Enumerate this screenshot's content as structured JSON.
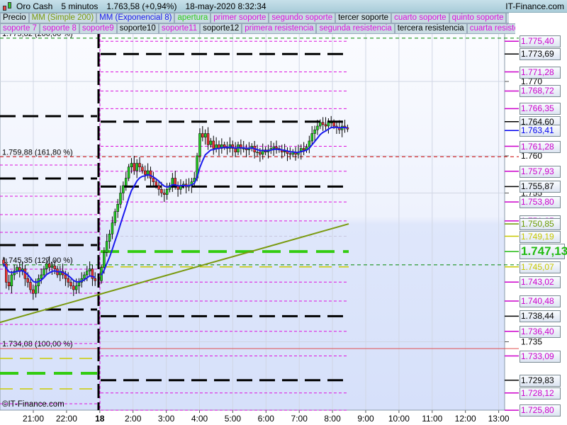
{
  "header": {
    "instrument": "Oro Cash",
    "timeframe": "5 minutos",
    "price": "1.763,58 (+0,94%)",
    "datetime": "18-may-2020 8:32:34",
    "site": "IT-Finance.com"
  },
  "legend_row1": [
    {
      "label": "Precio",
      "color": "#000000"
    },
    {
      "label": "MM (Simple 200)",
      "color": "#7a9a10"
    },
    {
      "label": "MM (Exponencial 8)",
      "color": "#1a1aee"
    },
    {
      "label": "apertura",
      "color": "#33cc22"
    },
    {
      "label": "primer soporte",
      "color": "#dd11dd"
    },
    {
      "label": "segundo soporte",
      "color": "#dd11dd"
    },
    {
      "label": "tercer soporte",
      "color": "#000000"
    },
    {
      "label": "cuarto soporte",
      "color": "#dd11dd"
    },
    {
      "label": "quinto soporte",
      "color": "#dd11dd"
    },
    {
      "label": "sexto soporte",
      "color": "#000000"
    }
  ],
  "legend_row2": [
    {
      "label": "soporte 7",
      "color": "#dd11dd"
    },
    {
      "label": "soporte 8",
      "color": "#dd11dd"
    },
    {
      "label": "soporte9",
      "color": "#dd11dd"
    },
    {
      "label": "soporte10",
      "color": "#000000"
    },
    {
      "label": "soporte11",
      "color": "#dd11dd"
    },
    {
      "label": "soporte12",
      "color": "#000000"
    },
    {
      "label": "primera resistencia",
      "color": "#dd11dd"
    },
    {
      "label": "segunda resistencia",
      "color": "#dd11dd"
    },
    {
      "label": "tercera resistencia",
      "color": "#000000"
    },
    {
      "label": "cuarta resistencia",
      "color": "#dd11dd"
    },
    {
      "label": "quinta resistencia",
      "color": "#dd11dd"
    }
  ],
  "chart_data": {
    "type": "candlestick",
    "ylim": [
      1725.2,
      1777.0
    ],
    "x_ticks": [
      "21:00",
      "22:00",
      "18",
      "2:00",
      "3:00",
      "4:00",
      "5:00",
      "6:00",
      "7:00",
      "8:00",
      "9:00",
      "10:00",
      "11:00",
      "12:00",
      "13:00"
    ],
    "y_ticks": [
      {
        "value": 1770,
        "label": "1.770"
      },
      {
        "value": 1760,
        "label": "1.760"
      },
      {
        "value": 1755,
        "label": "1.755"
      },
      {
        "value": 1735,
        "label": "1.735"
      }
    ],
    "closes_prev_session": [
      1745.5,
      1743,
      1742.5,
      1744,
      1744.5,
      1745,
      1744.5,
      1744.8,
      1743.5,
      1743,
      1742,
      1741.5,
      1742.5,
      1743.5,
      1744,
      1744.8,
      1745.5,
      1745,
      1745.2,
      1744.8,
      1744,
      1744.5,
      1744,
      1743.5,
      1743,
      1742.5,
      1742,
      1742.5,
      1743,
      1743.5,
      1744,
      1744.5,
      1744.8,
      1743.5,
      1743.2
    ],
    "closes_session": [
      1745,
      1747,
      1748.5,
      1749.5,
      1751,
      1752.5,
      1753.5,
      1755,
      1756,
      1757,
      1758.5,
      1759,
      1758,
      1759,
      1758.5,
      1758,
      1757.5,
      1758,
      1757,
      1756.5,
      1756,
      1755.5,
      1755,
      1754.8,
      1755.5,
      1756,
      1757,
      1756,
      1755.5,
      1756,
      1756.2,
      1755.8,
      1756,
      1756.5,
      1757,
      1760,
      1763,
      1762.5,
      1763,
      1761.5,
      1762,
      1761,
      1761.5,
      1761,
      1761.5,
      1761.2,
      1761,
      1761.5,
      1761,
      1760.5,
      1761.5,
      1761,
      1761,
      1760.8,
      1761,
      1761.3,
      1760.5,
      1760.5,
      1760.2,
      1760.8,
      1760.5,
      1760.8,
      1761,
      1761.2,
      1761,
      1760.8,
      1760.5,
      1760.6,
      1760.3,
      1760.2,
      1760.5,
      1760.2,
      1760.5,
      1761,
      1760.8,
      1761.2,
      1762,
      1763,
      1763.5,
      1764,
      1764.5,
      1764.2,
      1764,
      1764.5,
      1764.5,
      1764,
      1763.8,
      1763.5,
      1764,
      1763.8,
      1763.6
    ],
    "sma200": {
      "start": 1737.6,
      "end": 1750.85
    },
    "fib_levels": [
      {
        "price": 1775.82,
        "label": "1.775,82 (200,00 %)",
        "color": "#008800"
      },
      {
        "price": 1759.88,
        "label": "1.759,88 (161,80 %)",
        "color": "#cc0000"
      },
      {
        "price": 1745.35,
        "label": "1.745,35 (127,00 %)",
        "color": "#008800"
      },
      {
        "price": 1734.08,
        "label": "1.734,08 (100,00 %)",
        "color": "#e05050"
      }
    ],
    "levels_session": [
      {
        "price": 1775.4,
        "color": "#dd11dd",
        "style": "thin"
      },
      {
        "price": 1773.69,
        "color": "#000000",
        "style": "thick"
      },
      {
        "price": 1771.28,
        "color": "#dd11dd",
        "style": "thin"
      },
      {
        "price": 1768.72,
        "color": "#dd11dd",
        "style": "thin"
      },
      {
        "price": 1766.35,
        "color": "#dd11dd",
        "style": "thin"
      },
      {
        "price": 1764.6,
        "color": "#000000",
        "style": "thick"
      },
      {
        "price": 1761.28,
        "color": "#dd11dd",
        "style": "thin"
      },
      {
        "price": 1757.93,
        "color": "#dd11dd",
        "style": "thin"
      },
      {
        "price": 1755.87,
        "color": "#000000",
        "style": "thick"
      },
      {
        "price": 1753.8,
        "color": "#dd11dd",
        "style": "thin"
      },
      {
        "price": 1751.25,
        "color": "#dd11dd",
        "style": "thin"
      },
      {
        "price": 1749.19,
        "color": "#c8c8e0",
        "style": "thin"
      },
      {
        "price": 1747.13,
        "color": "#33cc11",
        "style": "open"
      },
      {
        "price": 1745.07,
        "color": "#cccc00",
        "style": "yellow"
      },
      {
        "price": 1743.02,
        "color": "#dd11dd",
        "style": "thin"
      },
      {
        "price": 1740.48,
        "color": "#dd11dd",
        "style": "thin"
      },
      {
        "price": 1738.44,
        "color": "#000000",
        "style": "thick"
      },
      {
        "price": 1736.4,
        "color": "#dd11dd",
        "style": "thin"
      },
      {
        "price": 1733.09,
        "color": "#dd11dd",
        "style": "thin"
      },
      {
        "price": 1729.83,
        "color": "#000000",
        "style": "thick"
      },
      {
        "price": 1728.12,
        "color": "#dd11dd",
        "style": "thin"
      },
      {
        "price": 1725.8,
        "color": "#dd11dd",
        "style": "thin"
      }
    ],
    "levels_prev_session": [
      {
        "price": 1765.33,
        "color": "#000000",
        "style": "thick"
      },
      {
        "price": 1758.76,
        "color": "#dd11dd",
        "style": "thin"
      },
      {
        "price": 1756.95,
        "color": "#000000",
        "style": "thick"
      },
      {
        "price": 1754.57,
        "color": "#dd11dd",
        "style": "thin"
      },
      {
        "price": 1752.1,
        "color": "#dd11dd",
        "style": "thin"
      },
      {
        "price": 1749.71,
        "color": "#dd11dd",
        "style": "thin"
      },
      {
        "price": 1748.0,
        "color": "#000000",
        "style": "thick"
      },
      {
        "price": 1744.76,
        "color": "#dd11dd",
        "style": "thin"
      },
      {
        "price": 1741.52,
        "color": "#dd11dd",
        "style": "thin"
      },
      {
        "price": 1739.33,
        "color": "#000000",
        "style": "thick"
      },
      {
        "price": 1737.33,
        "color": "#dd11dd",
        "style": "thin"
      },
      {
        "price": 1734.76,
        "color": "#dd11dd",
        "style": "thin"
      },
      {
        "price": 1732.76,
        "color": "#cccc00",
        "style": "yellow"
      },
      {
        "price": 1730.76,
        "color": "#33cc11",
        "style": "open"
      },
      {
        "price": 1728.67,
        "color": "#cccc00",
        "style": "yellow"
      },
      {
        "price": 1726.67,
        "color": "#dd11dd",
        "style": "thin"
      }
    ]
  },
  "axis_labels": [
    {
      "price": 1775.4,
      "label": "1.775,40",
      "color": "#cc00cc"
    },
    {
      "price": 1773.69,
      "label": "1.773,69",
      "color": "#000000"
    },
    {
      "price": 1771.28,
      "label": "1.771,28",
      "color": "#cc00cc"
    },
    {
      "price": 1768.72,
      "label": "1.768,72",
      "color": "#cc00cc"
    },
    {
      "price": 1766.35,
      "label": "1.766,35",
      "color": "#cc00cc"
    },
    {
      "price": 1764.6,
      "label": "1.764,60",
      "color": "#000000"
    },
    {
      "price": 1763.41,
      "label": "1.763,41",
      "color": "#0000ee"
    },
    {
      "price": 1761.28,
      "label": "1.761,28",
      "color": "#cc00cc"
    },
    {
      "price": 1757.93,
      "label": "1.757,93",
      "color": "#cc00cc"
    },
    {
      "price": 1755.87,
      "label": "1.755,87",
      "color": "#000000"
    },
    {
      "price": 1753.8,
      "label": "1.753,80",
      "color": "#cc00cc"
    },
    {
      "price": 1751.25,
      "label": "1.751,25",
      "color": "#cc00cc"
    },
    {
      "price": 1750.85,
      "label": "1.750,85",
      "color": "#6a9a00"
    },
    {
      "price": 1749.19,
      "label": "1.749,19",
      "color": "#c8c800"
    },
    {
      "price": 1745.07,
      "label": "1.745,07",
      "color": "#c8c800"
    },
    {
      "price": 1743.02,
      "label": "1.743,02",
      "color": "#cc00cc"
    },
    {
      "price": 1740.48,
      "label": "1.740,48",
      "color": "#cc00cc"
    },
    {
      "price": 1738.44,
      "label": "1.738,44",
      "color": "#000000"
    },
    {
      "price": 1736.4,
      "label": "1.736,40",
      "color": "#cc00cc"
    },
    {
      "price": 1733.09,
      "label": "1.733,09",
      "color": "#cc00cc"
    },
    {
      "price": 1729.83,
      "label": "1.729,83",
      "color": "#000000"
    },
    {
      "price": 1728.12,
      "label": "1.728,12",
      "color": "#cc00cc"
    },
    {
      "price": 1725.8,
      "label": "1.725,80",
      "color": "#cc00cc"
    }
  ],
  "current_price_label": {
    "price": 1747.13,
    "label": "1.747,13",
    "color": "#22bb11"
  },
  "copyright": "©IT-Finance.com"
}
